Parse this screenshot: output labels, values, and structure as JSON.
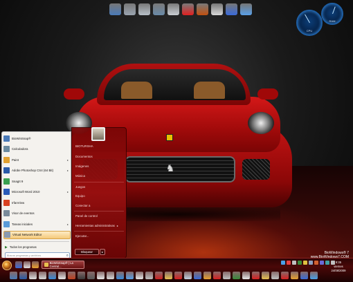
{
  "top_dock": {
    "icons": [
      {
        "name": "computer-icon",
        "color": "#4a7ab8"
      },
      {
        "name": "drive-icon",
        "color": "#9aa4b0"
      },
      {
        "name": "printer-icon",
        "color": "#b8c0c8"
      },
      {
        "name": "phone-icon",
        "color": "#6a8aa8"
      },
      {
        "name": "tower-icon",
        "color": "#c8cdd2"
      },
      {
        "name": "lifesaver-icon",
        "color": "#e02020"
      },
      {
        "name": "flame-icon",
        "color": "#c05010"
      },
      {
        "name": "adobe-icon",
        "color": "#d8d8d8"
      },
      {
        "name": "photo-icon",
        "color": "#3a6ad8"
      },
      {
        "name": "network-icon",
        "color": "#5aa0e8"
      }
    ]
  },
  "start_menu": {
    "programs": [
      {
        "label": "BioWinSnap®",
        "icon_color": "#4a7ab8",
        "has_arrow": false,
        "highlight": false
      },
      {
        "label": "Calculadora",
        "icon_color": "#6a8aa0",
        "has_arrow": false,
        "highlight": false
      },
      {
        "label": "Paint",
        "icon_color": "#e0a030",
        "has_arrow": true,
        "highlight": false
      },
      {
        "label": "Adobe Photoshop CS4 (64 Bit)",
        "icon_color": "#2a5aa8",
        "has_arrow": true,
        "highlight": false
      },
      {
        "label": "SnagIt 9",
        "icon_color": "#3aa050",
        "has_arrow": false,
        "highlight": false
      },
      {
        "label": "Microsoft Word 2010",
        "icon_color": "#2a5ab8",
        "has_arrow": true,
        "highlight": false
      },
      {
        "label": "IrfanView",
        "icon_color": "#d84020",
        "has_arrow": false,
        "highlight": false
      },
      {
        "label": "Visor de eventos",
        "icon_color": "#7a8a9a",
        "has_arrow": false,
        "highlight": false
      },
      {
        "label": "Tareas iniciales",
        "icon_color": "#5a9ad8",
        "has_arrow": true,
        "highlight": false
      },
      {
        "label": "Virtual Network Editor",
        "icon_color": "#8a9ab0",
        "has_arrow": false,
        "highlight": true
      }
    ],
    "all_programs": "Todos los programas",
    "search_placeholder": "Buscar programas y archivos",
    "user_name": "BIOTURSHA",
    "right_items": [
      {
        "label": "Documentos",
        "has_arrow": false
      },
      {
        "label": "Imágenes",
        "has_arrow": false
      },
      {
        "label": "Música",
        "has_arrow": false
      },
      {
        "label": "Juegos",
        "has_arrow": false
      },
      {
        "label": "Equipo",
        "has_arrow": false
      },
      {
        "label": "Conectar a",
        "has_arrow": false
      },
      {
        "label": "Panel de control",
        "has_arrow": false
      },
      {
        "label": "Herramientas administrativas",
        "has_arrow": true
      },
      {
        "label": "Ejecutar...",
        "has_arrow": false
      }
    ],
    "shutdown_label": "Bloquear",
    "shutdown_arrow": "▸"
  },
  "gauges": [
    {
      "label": "CPU"
    },
    {
      "label": "RAM"
    }
  ],
  "wallpaper": {
    "watermark_line1": "BioWindows® 7",
    "watermark_line2": "www.BioWindows7.COM"
  },
  "taskbar": {
    "active_task": "BioWinSnap® | La Central...",
    "clock_time": "9:35",
    "clock_day": "viernes",
    "clock_date": "24/08/2009",
    "quick_launch": [
      "#3a6ad8",
      "#e0e0e0",
      "#e8a030"
    ],
    "tray": [
      "#4aa0e8",
      "#e84040",
      "#c0c0c0",
      "#3a8a3a",
      "#e0c040",
      "#8aa0c0",
      "#d06030",
      "#6a6ad8",
      "#40a0a0",
      "#c0c0c0"
    ],
    "dock": [
      "#4a7ab8",
      "#2a5aa8",
      "#e0e0e0",
      "#d8d8d8",
      "#3a8ad8",
      "#e8e8e8",
      "#c04020",
      "#3a3a3a",
      "#5a5a5a",
      "#e8e8e8",
      "#d8d8d8",
      "#3a8ad8",
      "#5aa0e8",
      "#e8e8e8",
      "#c0c0c0",
      "#d02020",
      "#e8c050",
      "#d82020",
      "#c0d0e0",
      "#3a6ad8",
      "#e8a030",
      "#d82020",
      "#c0c0c0",
      "#3a8a3a",
      "#e8e8e8",
      "#d82020",
      "#e8c050",
      "#c0c0c0",
      "#d82020",
      "#e8a030",
      "#3a6ad8",
      "#4aa0e8"
    ]
  }
}
